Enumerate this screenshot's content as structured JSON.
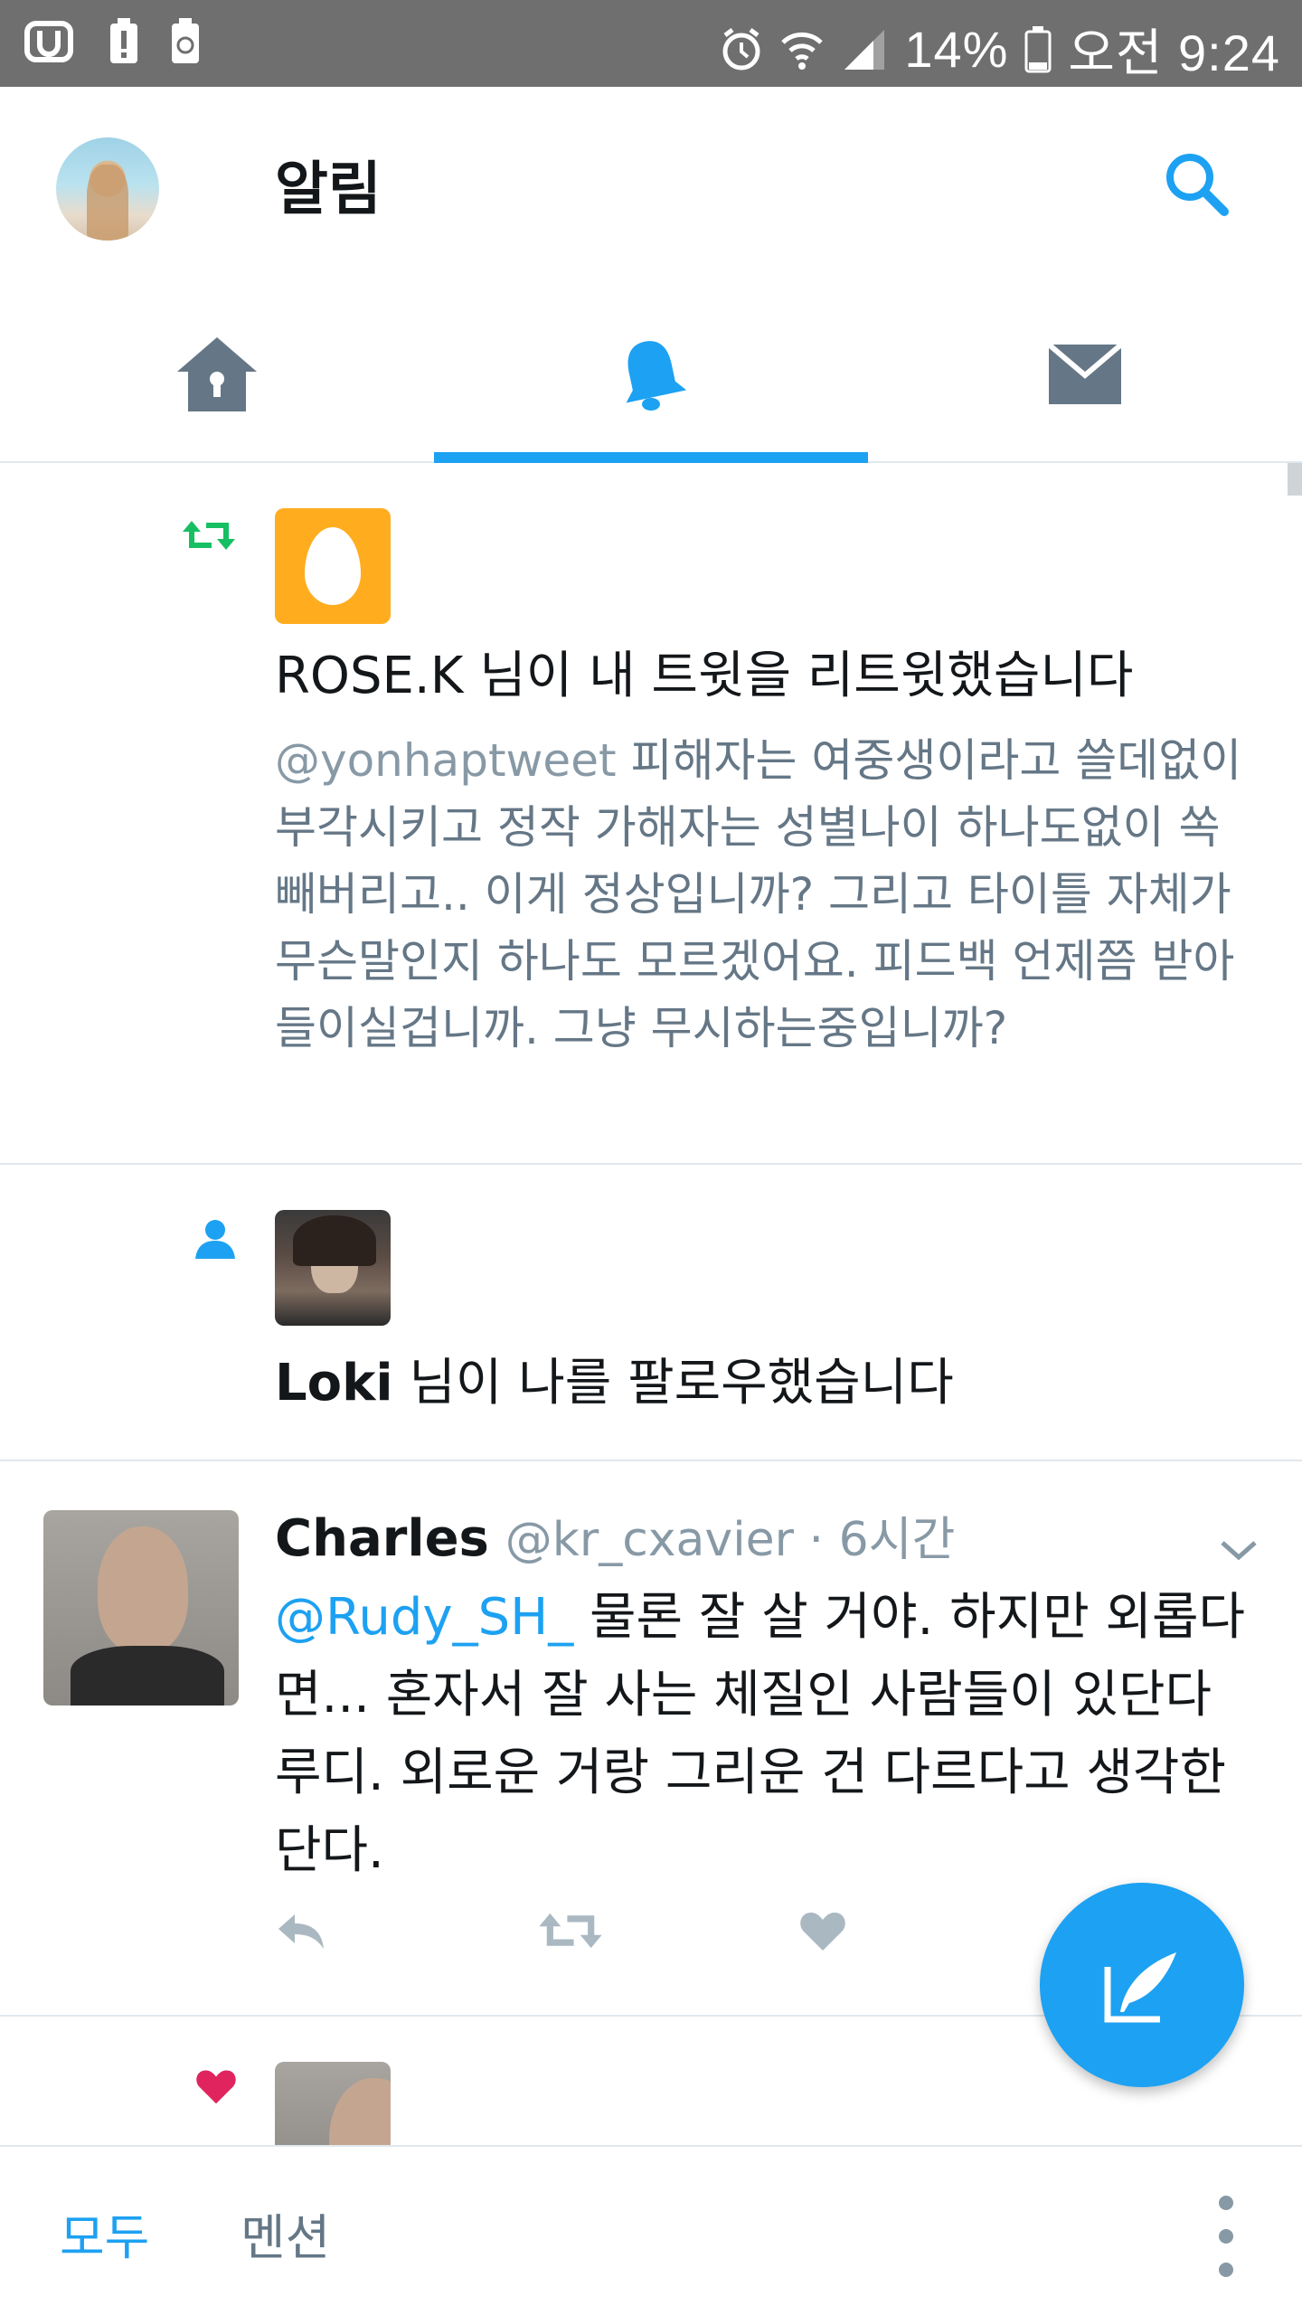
{
  "status_bar": {
    "battery": "14%",
    "time": "오전 9:24"
  },
  "header": {
    "title": "알림"
  },
  "tabs": [
    {
      "name": "home",
      "active": false
    },
    {
      "name": "notifications",
      "active": true
    },
    {
      "name": "messages",
      "active": false
    }
  ],
  "notifications": {
    "retweet": {
      "user": "ROSE.K",
      "action": " 님이 내 트윗을 리트윗했습니다",
      "handle": "@yonhaptweet",
      "text": " 피해자는 여중생이라고 쓸데없이 부각시키고 정작 가해자는 성별나이 하나도없이 쏙 빼버리고.. 이게 정상입니까? 그리고 타이틀 자체가 무슨말인지 하나도 모르겠어요. 피드백 언제쯤 받아들이실겁니까. 그냥 무시하는중입니까?"
    },
    "follow": {
      "user": "Loki",
      "action": " 님이 나를 팔로우했습니다"
    },
    "mention_tweet": {
      "name": "Charles",
      "handle": "@kr_cxavier",
      "time": " · 6시간",
      "mention": "@Rudy_SH_",
      "text": " 물론 잘 살 거야. 하지만 외롭다면... 혼자서 잘 사는 체질인 사람들이 있단다 루디. 외로운 거랑 그리운 건 다르다고 생각한단다."
    }
  },
  "bottom_bar": {
    "filter_all": "모두",
    "filter_mentions": "멘션"
  },
  "colors": {
    "accent": "#1da1f2",
    "retweet_green": "#17bf63",
    "like_red": "#e0245e",
    "muted": "#657786"
  }
}
